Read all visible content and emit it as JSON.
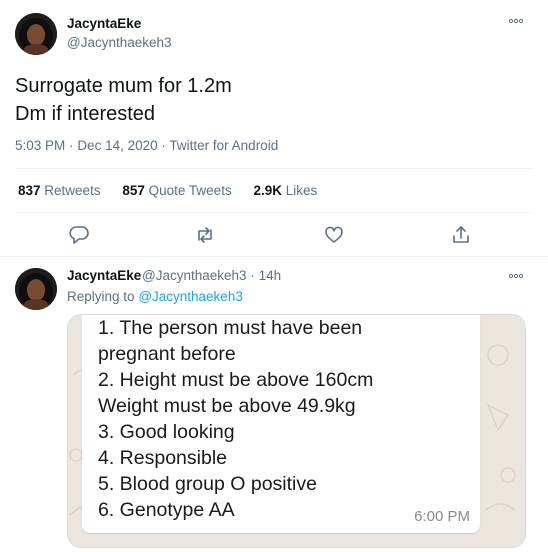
{
  "tweet": {
    "user": {
      "name": "JacyntaEke",
      "handle": "@Jacynthaekeh3"
    },
    "text_lines": [
      "Surrogate mum for 1.2m",
      "Dm if interested"
    ],
    "meta": {
      "time": "5:03 PM",
      "sep": "·",
      "date": "Dec 14, 2020",
      "source": "Twitter for Android"
    },
    "stats": [
      {
        "count": "837",
        "label": "Retweets"
      },
      {
        "count": "857",
        "label": "Quote Tweets"
      },
      {
        "count": "2.9K",
        "label": "Likes"
      }
    ],
    "actions": [
      "reply-icon",
      "retweet-icon",
      "like-icon",
      "share-icon"
    ]
  },
  "reply": {
    "user": {
      "name": "JacyntaEke",
      "handle": "@Jacynthaekeh3",
      "sep": "·",
      "age": "14h"
    },
    "replying_prefix": "Replying to",
    "replying_to": "@Jacynthaekeh3",
    "image": {
      "lines": [
        "1. The person must have been",
        "pregnant before",
        "2. Height must be above 160cm",
        "Weight must be above 49.9kg",
        "3. Good looking",
        "4. Responsible",
        "5. Blood group O positive",
        "6. Genotype AA"
      ],
      "time": "6:00 PM"
    }
  },
  "colors": {
    "accent": "#1da1f2",
    "secondary_text": "#5b7083",
    "icon": "#5b7083",
    "chat_bg": "#ece5dd"
  }
}
